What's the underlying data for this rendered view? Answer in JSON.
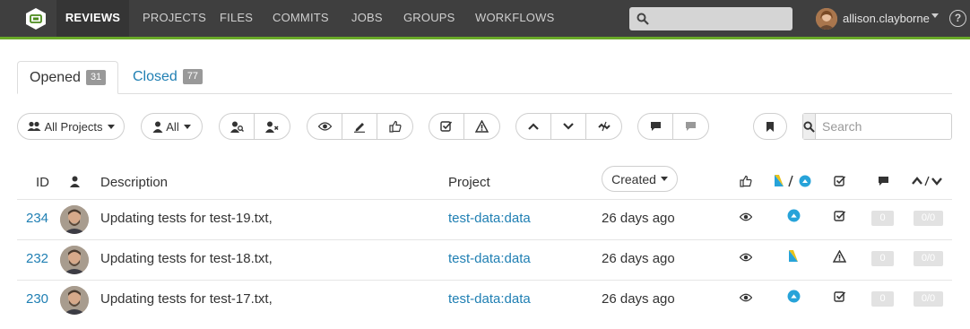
{
  "nav": {
    "items": [
      "REVIEWS",
      "PROJECTS",
      "FILES",
      "COMMITS",
      "JOBS",
      "GROUPS",
      "WORKFLOWS"
    ],
    "active": "REVIEWS",
    "search_placeholder": "",
    "user": "allison.clayborne",
    "help": "?"
  },
  "tabs": {
    "opened_label": "Opened",
    "opened_count": "31",
    "closed_label": "Closed",
    "closed_count": "77"
  },
  "toolbar": {
    "projects_label": "All Projects",
    "users_label": "All",
    "search_placeholder": "Search"
  },
  "table": {
    "headers": {
      "id": "ID",
      "description": "Description",
      "project": "Project",
      "sort": "Created"
    },
    "rows": [
      {
        "id": "234",
        "description": "Updating tests for test-19.txt,",
        "project": "test-data:data",
        "created": "26 days ago",
        "status": "approved",
        "test": "pass",
        "comments": "0",
        "votes": "0/0"
      },
      {
        "id": "232",
        "description": "Updating tests for test-18.txt,",
        "project": "test-data:data",
        "created": "26 days ago",
        "status": "pending",
        "test": "warn",
        "comments": "0",
        "votes": "0/0"
      },
      {
        "id": "230",
        "description": "Updating tests for test-17.txt,",
        "project": "test-data:data",
        "created": "26 days ago",
        "status": "approved",
        "test": "pass",
        "comments": "0",
        "votes": "0/0"
      }
    ]
  },
  "colors": {
    "nav_bg": "#3f3f3f",
    "accent_green": "#6aaa28",
    "link_blue": "#1f7fb3",
    "status_blue": "#27a3d9",
    "pending_yellow": "#e8c21a"
  }
}
